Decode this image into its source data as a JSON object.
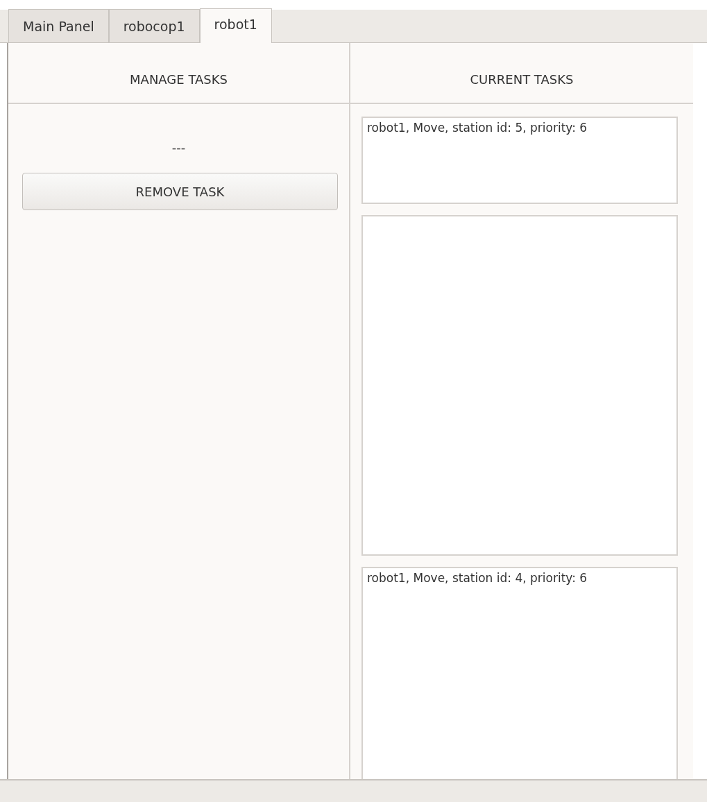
{
  "tabs": [
    {
      "label": "Main Panel",
      "selected": false
    },
    {
      "label": "robocop1",
      "selected": false
    },
    {
      "label": "robot1",
      "selected": true
    }
  ],
  "manage": {
    "title": "MANAGE TASKS",
    "selection": "---",
    "button": "REMOVE TASK"
  },
  "current": {
    "title": "CURRENT TASKS",
    "tasks": [
      {
        "kind": "task",
        "text": "robot1, Move, station id: 5, priority: 6"
      },
      {
        "kind": "empty"
      },
      {
        "kind": "task",
        "text": "robot1, Move, station id: 4, priority: 6"
      }
    ]
  }
}
